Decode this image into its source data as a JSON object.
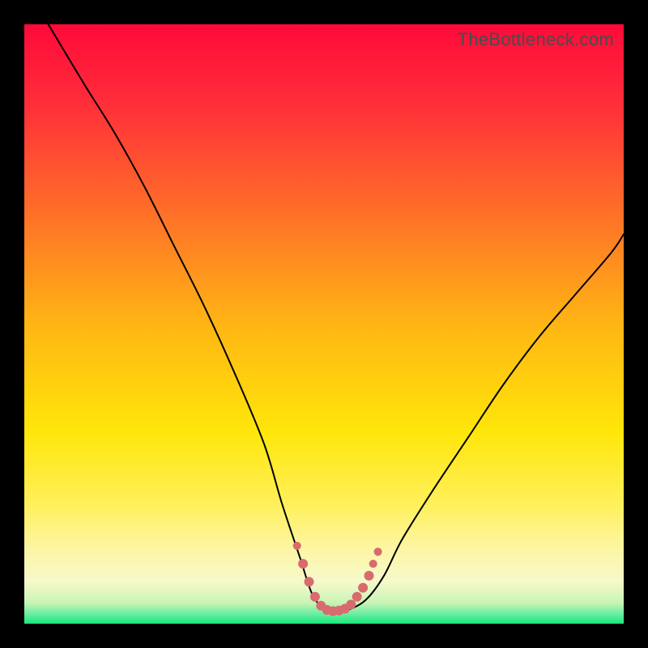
{
  "watermark": "TheBottleneck.com",
  "colors": {
    "frame_bg": "#000000",
    "curve": "#000000",
    "marker_fill": "#d96a6e",
    "marker_stroke": "#d96a6e",
    "green_band": "#17e87a"
  },
  "chart_data": {
    "type": "line",
    "title": "",
    "xlabel": "",
    "ylabel": "",
    "xlim": [
      0,
      100
    ],
    "ylim": [
      0,
      100
    ],
    "grid": false,
    "legend": false,
    "annotations": [
      "TheBottleneck.com"
    ],
    "gradient_stops": [
      {
        "pos": 0.0,
        "color": "#ff0a3a"
      },
      {
        "pos": 0.12,
        "color": "#ff2a3a"
      },
      {
        "pos": 0.3,
        "color": "#ff6a2a"
      },
      {
        "pos": 0.5,
        "color": "#ffb514"
      },
      {
        "pos": 0.68,
        "color": "#ffe60a"
      },
      {
        "pos": 0.8,
        "color": "#fff05a"
      },
      {
        "pos": 0.88,
        "color": "#fdf6a8"
      },
      {
        "pos": 0.93,
        "color": "#f6f9cb"
      },
      {
        "pos": 0.965,
        "color": "#c9f4b6"
      },
      {
        "pos": 0.985,
        "color": "#63eda0"
      },
      {
        "pos": 1.0,
        "color": "#17e87a"
      }
    ],
    "series": [
      {
        "name": "bottleneck-curve",
        "x": [
          4,
          10,
          15,
          20,
          25,
          30,
          35,
          40,
          43,
          46,
          48,
          50,
          52,
          54,
          57,
          60,
          63,
          68,
          74,
          80,
          86,
          92,
          98,
          100
        ],
        "y": [
          100,
          90,
          82,
          73,
          63,
          53,
          42,
          30,
          20,
          11,
          5,
          2.5,
          2,
          2.3,
          4,
          8,
          14,
          22,
          31,
          40,
          48,
          55,
          62,
          65
        ]
      }
    ],
    "curve_flat_region": {
      "x_start": 48,
      "x_end": 56,
      "y": 2.3
    },
    "markers": [
      {
        "x": 45.5,
        "y": 13,
        "r": 5
      },
      {
        "x": 46.5,
        "y": 10,
        "r": 6
      },
      {
        "x": 47.5,
        "y": 7,
        "r": 6
      },
      {
        "x": 48.5,
        "y": 4.5,
        "r": 6
      },
      {
        "x": 49.5,
        "y": 3.0,
        "r": 6
      },
      {
        "x": 50.5,
        "y": 2.3,
        "r": 6
      },
      {
        "x": 51.5,
        "y": 2.1,
        "r": 6
      },
      {
        "x": 52.5,
        "y": 2.2,
        "r": 6
      },
      {
        "x": 53.5,
        "y": 2.5,
        "r": 6
      },
      {
        "x": 54.5,
        "y": 3.2,
        "r": 6
      },
      {
        "x": 55.5,
        "y": 4.5,
        "r": 6
      },
      {
        "x": 56.5,
        "y": 6.0,
        "r": 6
      },
      {
        "x": 57.5,
        "y": 8.0,
        "r": 6
      },
      {
        "x": 58.2,
        "y": 10.0,
        "r": 5
      },
      {
        "x": 59.0,
        "y": 12.0,
        "r": 5
      }
    ]
  }
}
